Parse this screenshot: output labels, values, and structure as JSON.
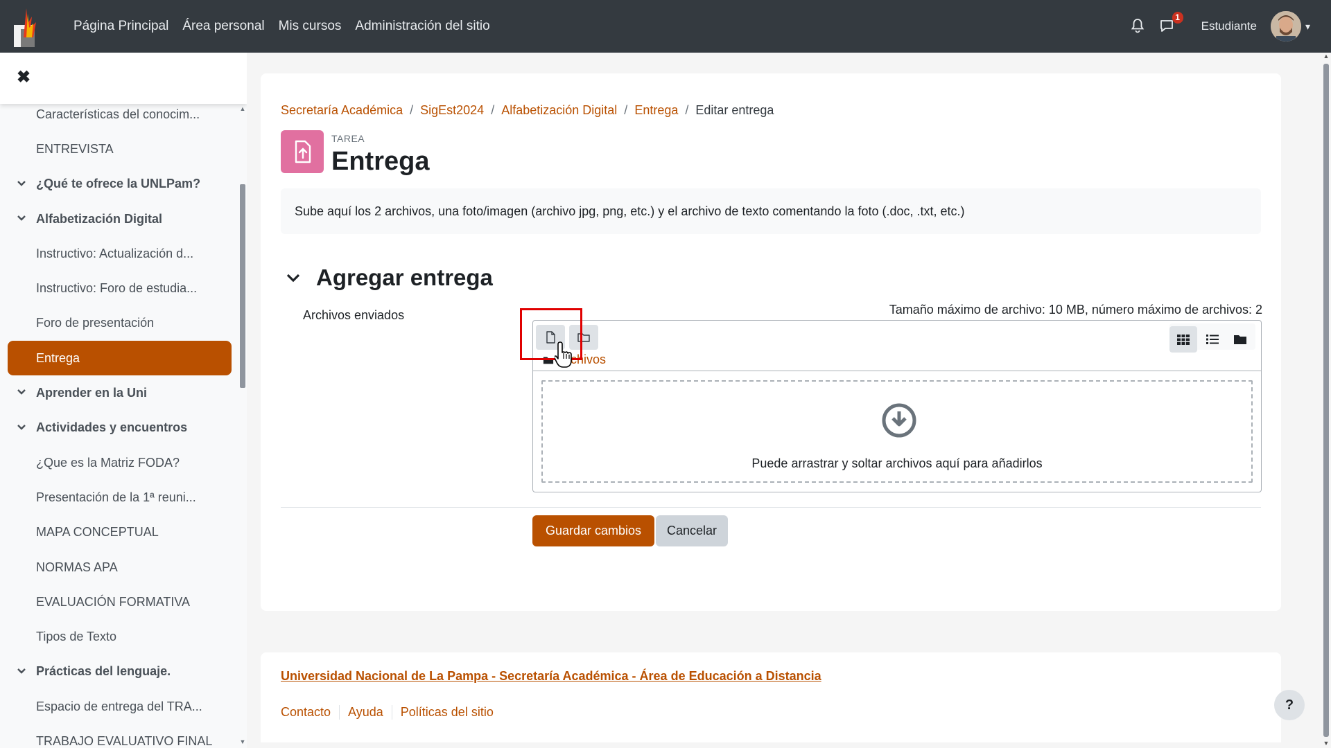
{
  "navbar": {
    "links": [
      "Página Principal",
      "Área personal",
      "Mis cursos",
      "Administración del sitio"
    ],
    "notifications_icon": "bell-icon",
    "messages_icon": "chat-icon",
    "messages_badge": "1",
    "user_name": "Estudiante"
  },
  "sidebar": {
    "items": [
      {
        "label": "Características del conocim...",
        "type": "item"
      },
      {
        "label": "ENTREVISTA",
        "type": "item"
      },
      {
        "label": "¿Qué te ofrece la UNLPam?",
        "type": "section"
      },
      {
        "label": "Alfabetización Digital",
        "type": "section"
      },
      {
        "label": "Instructivo: Actualización d...",
        "type": "item"
      },
      {
        "label": "Instructivo: Foro de estudia...",
        "type": "item"
      },
      {
        "label": "Foro de presentación",
        "type": "item"
      },
      {
        "label": "Entrega",
        "type": "active"
      },
      {
        "label": "Aprender en la Uni",
        "type": "section"
      },
      {
        "label": "Actividades y encuentros",
        "type": "section"
      },
      {
        "label": "¿Que es la Matriz FODA?",
        "type": "item"
      },
      {
        "label": "Presentación de la 1ª reuni...",
        "type": "item"
      },
      {
        "label": "MAPA CONCEPTUAL",
        "type": "item"
      },
      {
        "label": "NORMAS APA",
        "type": "item"
      },
      {
        "label": "EVALUACIÓN FORMATIVA",
        "type": "item"
      },
      {
        "label": "Tipos de Texto",
        "type": "item"
      },
      {
        "label": "Prácticas del lenguaje.",
        "type": "section"
      },
      {
        "label": "Espacio de entrega del TRA...",
        "type": "item"
      },
      {
        "label": "TRABAJO EVALUATIVO FINAL",
        "type": "item"
      }
    ]
  },
  "breadcrumb": [
    "Secretaría Académica",
    "SigEst2024",
    "Alfabetización Digital",
    "Entrega"
  ],
  "breadcrumb_current": "Editar entrega",
  "activity": {
    "type": "TAREA",
    "title": "Entrega"
  },
  "intro": "Sube aquí los 2 archivos, una foto/imagen (archivo jpg, png, etc.) y el archivo de texto comentando la foto (.doc, .txt, etc.)",
  "section_title": "Agregar entrega",
  "filepicker": {
    "label": "Archivos enviados",
    "max_size": "Tamaño máximo de archivo: 10 MB, número máximo de archivos: 2",
    "path": "Archivos",
    "drop_text": "Puede arrastrar y soltar archivos aquí para añadirlos"
  },
  "buttons": {
    "save": "Guardar cambios",
    "cancel": "Cancelar"
  },
  "footer": {
    "main_link": "Universidad Nacional de La Pampa - Secretaría Académica - Área de Educación a Distancia",
    "links": [
      "Contacto",
      "Ayuda",
      "Políticas del sitio"
    ]
  },
  "help": "?",
  "colors": {
    "brand": "#b95000",
    "navbar": "#343a40",
    "activity_icon_bg": "#e170a0",
    "highlight": "#e00000"
  }
}
